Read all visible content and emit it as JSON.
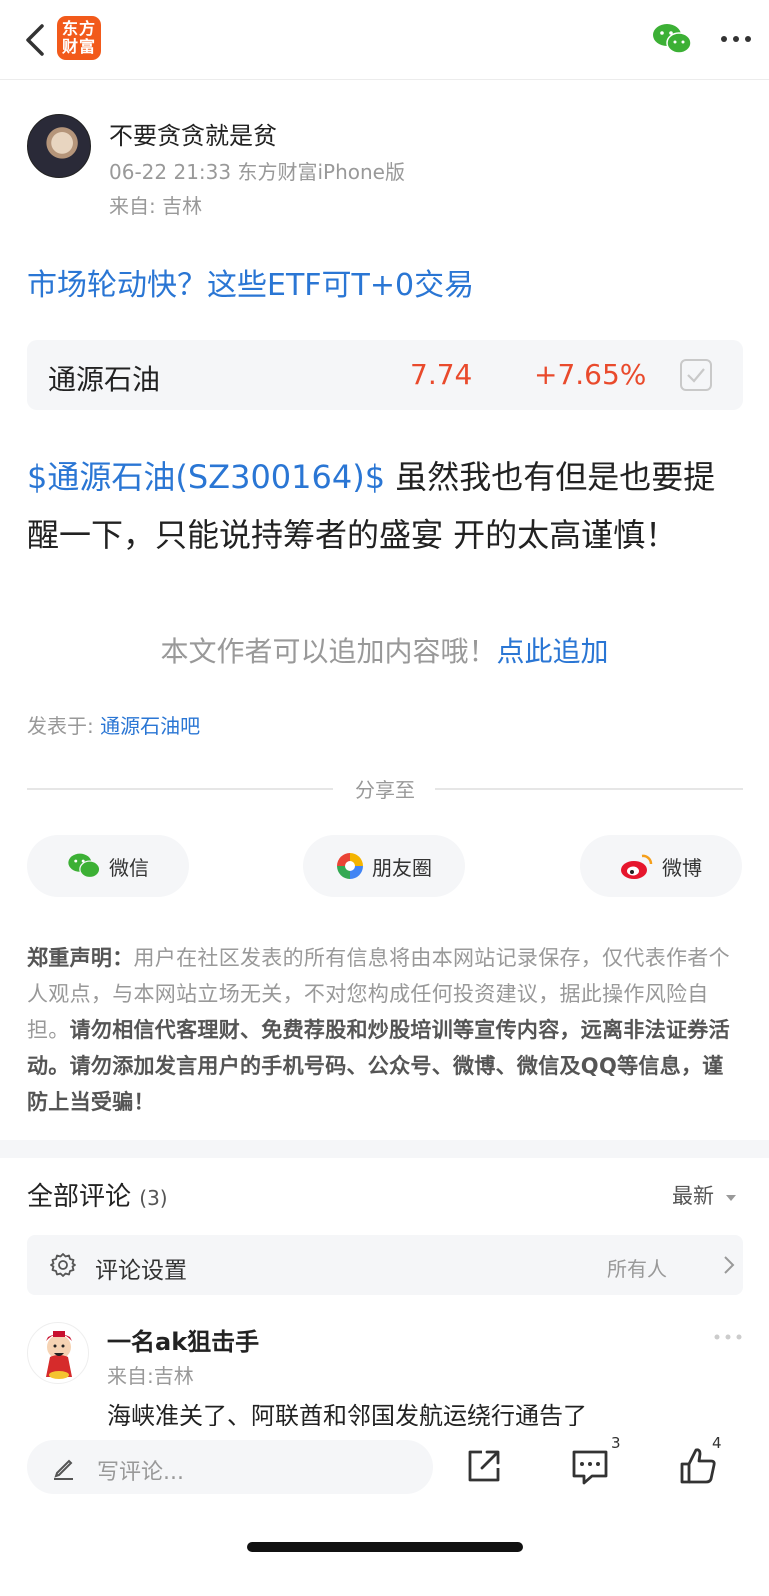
{
  "header": {
    "logo_line1": "东方",
    "logo_line2": "财富",
    "icons": [
      "back-icon",
      "wechat-icon",
      "more-icon"
    ],
    "accent_color": "#f25a1b"
  },
  "author": {
    "name": "不要贪贪就是贫",
    "meta": "06-22 21:33 东方财富iPhone版",
    "from": "来自: 吉林"
  },
  "ad_link": "市场轮动快？这些ETF可T+0交易",
  "stock_card": {
    "name": "通源石油",
    "price": "7.74",
    "change": "+7.65%",
    "up_color": "#e94a2c"
  },
  "post": {
    "tag": "$通源石油(SZ300164)$",
    "text_part1": " 虽然我也有但是也要提醒一下，只能说持筹者的盛宴 开的太高谨慎！"
  },
  "append": {
    "text": "本文作者可以追加内容哦！",
    "link": "点此追加"
  },
  "posted_in": {
    "label": "发表于: ",
    "bar": "通源石油吧"
  },
  "share": {
    "title": "分享至",
    "buttons": [
      {
        "label": "微信",
        "icon": "wechat-icon"
      },
      {
        "label": "朋友圈",
        "icon": "moments-icon"
      },
      {
        "label": "微博",
        "icon": "weibo-icon"
      }
    ]
  },
  "disclaimer": {
    "title": "郑重声明：",
    "normal": "用户在社区发表的所有信息将由本网站记录保存，仅代表作者个人观点，与本网站立场无关，不对您构成任何投资建议，据此操作风险自担。",
    "bold": "请勿相信代客理财、免费荐股和炒股培训等宣传内容，远离非法证券活动。请勿添加发言用户的手机号码、公众号、微博、微信及QQ等信息，谨防上当受骗！"
  },
  "comments": {
    "title": "全部评论",
    "count": "(3)",
    "sort": "最新",
    "settings_label": "评论设置",
    "settings_value": "所有人",
    "items": [
      {
        "name": "一名ak狙击手",
        "from": "来自:吉林",
        "text": "海峡准关了、阿联酋和邻国发航运绕行通告了"
      }
    ]
  },
  "bottom_bar": {
    "placeholder": "写评论...",
    "comment_count": "3",
    "like_count": "4"
  },
  "link_color": "#2a76d4"
}
